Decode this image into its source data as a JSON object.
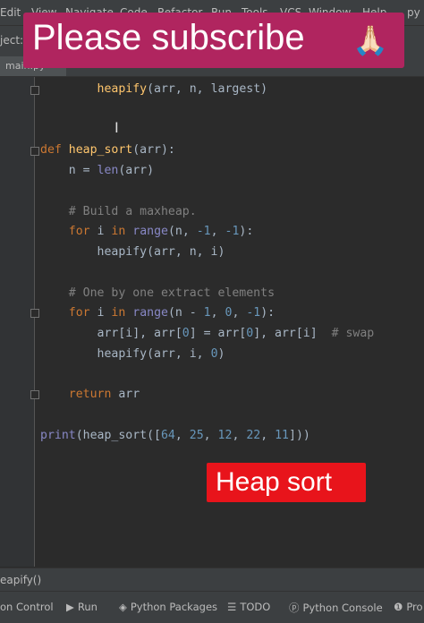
{
  "menu": [
    "Edit",
    "View",
    "Navigate",
    "Code",
    "Refactor",
    "Run",
    "Tools",
    "VCS",
    "Window",
    "Help",
    "py"
  ],
  "navbar": {
    "project": "ject:"
  },
  "tab": {
    "label": "main.py"
  },
  "banner": {
    "text": "Please subscribe",
    "emoji": "🙏🏻"
  },
  "overlay": {
    "label": "Heap sort"
  },
  "code": [
    "        heapify(arr, n, largest)",
    "def heap_sort(arr):",
    "    n = len(arr)",
    "    # Build a maxheap.",
    "    for i in range(n, -1, -1):",
    "        heapify(arr, n, i)",
    "    # One by one extract elements",
    "    for i in range(n - 1, 0, -1):",
    "        arr[i], arr[0] = arr[0], arr[i]  # swap",
    "        heapify(arr, i, 0)",
    "    return arr",
    "print(heap_sort([64, 25, 12, 22, 11]))"
  ],
  "breadcrumb": "eapify()",
  "toolwindows": [
    {
      "label": "on Control",
      "icon": ""
    },
    {
      "label": "Run",
      "icon": "▶"
    },
    {
      "label": "Python Packages",
      "icon": "◈"
    },
    {
      "label": "TODO",
      "icon": "☰"
    },
    {
      "label": "Python Console",
      "icon": "ⓟ"
    },
    {
      "label": "Pro",
      "icon": "❶"
    }
  ]
}
